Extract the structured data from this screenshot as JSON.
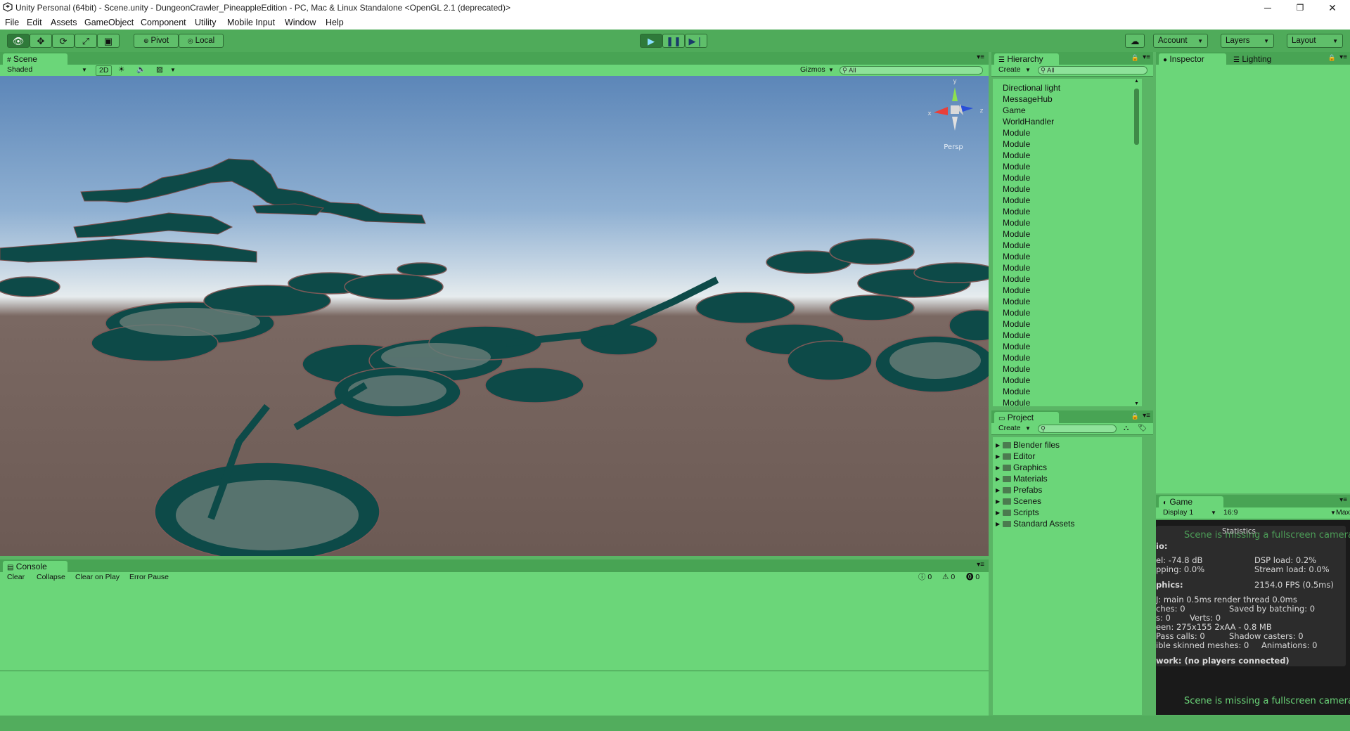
{
  "window": {
    "title": "Unity Personal (64bit) - Scene.unity - DungeonCrawler_PineappleEdition - PC, Mac & Linux Standalone <OpenGL 2.1 (deprecated)>",
    "minimize": "─",
    "restore": "❐",
    "close": "✕"
  },
  "menu": [
    "File",
    "Edit",
    "Assets",
    "GameObject",
    "Component",
    "Utility",
    "Mobile Input",
    "Window",
    "Help"
  ],
  "toolbar": {
    "pivot_label": "Pivot",
    "local_label": "Local",
    "account_label": "Account",
    "layers_label": "Layers",
    "layout_label": "Layout"
  },
  "scene": {
    "tab_label": "Scene",
    "shading_mode": "Shaded",
    "mode_2d": "2D",
    "gizmos_label": "Gizmos",
    "search_placeholder": "All",
    "persp_label": "Persp",
    "axis_y": "y",
    "axis_x": "x",
    "axis_z": "z"
  },
  "hierarchy": {
    "tab_label": "Hierarchy",
    "create_label": "Create",
    "search_placeholder": "All",
    "items": [
      "Directional light",
      "MessageHub",
      "Game",
      "WorldHandler",
      "Module",
      "Module",
      "Module",
      "Module",
      "Module",
      "Module",
      "Module",
      "Module",
      "Module",
      "Module",
      "Module",
      "Module",
      "Module",
      "Module",
      "Module",
      "Module",
      "Module",
      "Module",
      "Module",
      "Module",
      "Module",
      "Module",
      "Module",
      "Module",
      "Module"
    ]
  },
  "project": {
    "tab_label": "Project",
    "create_label": "Create",
    "folders": [
      "Blender files",
      "Editor",
      "Graphics",
      "Materials",
      "Prefabs",
      "Scenes",
      "Scripts",
      "Standard Assets"
    ]
  },
  "inspector": {
    "tab_label": "Inspector",
    "lighting_tab_label": "Lighting"
  },
  "game": {
    "tab_label": "Game",
    "display_label": "Display 1",
    "aspect_label": "16:9",
    "maximize_label": "Max",
    "stats_title": "Statistics",
    "missing_camera": "Scene is missing a fullscreen camera",
    "stats": {
      "audio_header": "io:",
      "level": "el: -74.8 dB",
      "dsp_load": "DSP load: 0.2%",
      "clipping": "pping: 0.0%",
      "stream_load": "Stream load: 0.0%",
      "graphics_header": "phics:",
      "fps": "2154.0 FPS (0.5ms)",
      "cpu": "J: main 0.5ms  render thread 0.0ms",
      "batches": "ches: 0",
      "saved_batching": "Saved by batching: 0",
      "tris": "s: 0",
      "verts": "Verts: 0",
      "screen": "een: 275x155 2xAA - 0.8 MB",
      "setpass": "Pass calls: 0",
      "shadow_casters": "Shadow casters: 0",
      "skinned": "ible skinned meshes: 0",
      "animations": "Animations: 0",
      "network": "work: (no players connected)"
    }
  },
  "console": {
    "tab_label": "Console",
    "clear_label": "Clear",
    "collapse_label": "Collapse",
    "clear_on_play_label": "Clear on Play",
    "error_pause_label": "Error Pause",
    "info_count": "0",
    "warning_count": "0",
    "error_count": "0"
  },
  "colors": {
    "editor_green": "#5ab565",
    "panel_green": "#6bd679",
    "dark_mesh": "#0d4a48",
    "sky_top": "#5c86b8",
    "ground": "#6c5a54"
  }
}
